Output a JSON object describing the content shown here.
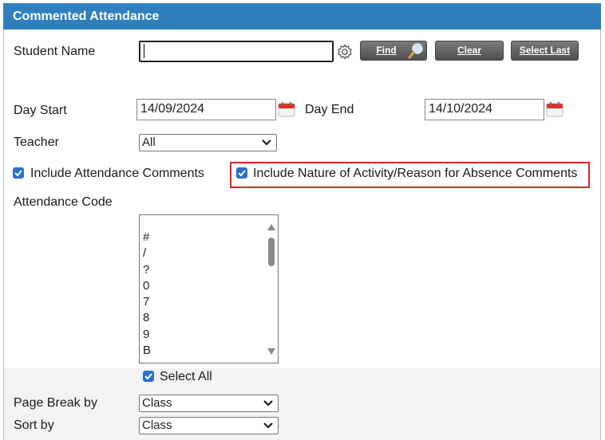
{
  "header": {
    "title": "Commented Attendance"
  },
  "student": {
    "label": "Student Name",
    "value": "",
    "find_label": "Find",
    "clear_label": "Clear",
    "select_last_label": "Select Last"
  },
  "dates": {
    "start_label": "Day Start",
    "start_value": "14/09/2024",
    "end_label": "Day End",
    "end_value": "14/10/2024"
  },
  "teacher": {
    "label": "Teacher",
    "selected": "All"
  },
  "options": {
    "include_attendance_comments": {
      "label": "Include Attendance Comments",
      "checked": true
    },
    "include_nature_comments": {
      "label": "Include Nature of Activity/Reason for Absence Comments",
      "checked": true
    }
  },
  "attendance_code": {
    "label": "Attendance Code",
    "items": [
      "#",
      "/",
      "?",
      "0",
      "7",
      "8",
      "9",
      "B"
    ],
    "select_all_label": "Select All"
  },
  "page_break": {
    "label": "Page Break by",
    "selected": "Class"
  },
  "sort": {
    "label": "Sort by",
    "selected": "Class"
  },
  "colors": {
    "header": "#2f7fbe",
    "checkbox": "#2a6fd1",
    "highlight": "#e02424"
  }
}
